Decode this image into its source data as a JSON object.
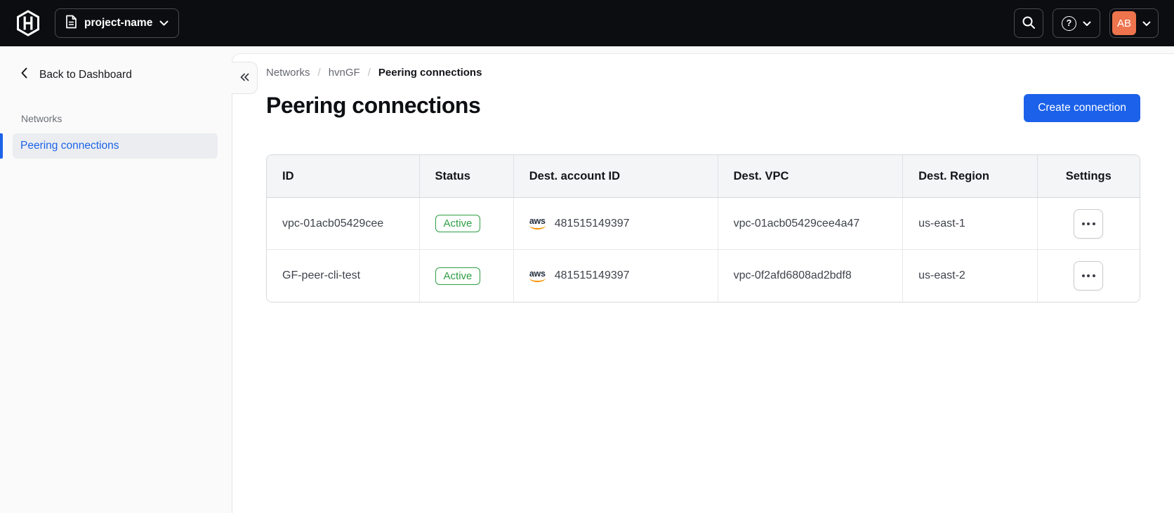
{
  "topbar": {
    "project_name": "project-name",
    "avatar_initials": "AB",
    "help_glyph": "?"
  },
  "sidebar": {
    "back_label": "Back to Dashboard",
    "section_label": "Networks",
    "items": [
      {
        "label": "Peering connections",
        "active": true
      }
    ]
  },
  "breadcrumb": {
    "separator": "/",
    "items": [
      "Networks",
      "hvnGF",
      "Peering connections"
    ]
  },
  "page": {
    "title": "Peering connections",
    "create_button_label": "Create connection"
  },
  "table": {
    "columns": [
      "ID",
      "Status",
      "Dest. account ID",
      "Dest. VPC",
      "Dest. Region",
      "Settings"
    ],
    "aws_label": "aws",
    "rows": [
      {
        "id": "vpc-01acb05429cee",
        "status": "Active",
        "dest_account_id": "481515149397",
        "dest_vpc": "vpc-01acb05429cee4a47",
        "dest_region": "us-east-1"
      },
      {
        "id": "GF-peer-cli-test",
        "status": "Active",
        "dest_account_id": "481515149397",
        "dest_vpc": "vpc-0f2afd6808ad2bdf8",
        "dest_region": "us-east-2"
      }
    ]
  },
  "colors": {
    "topbar_bg": "#0c0d11",
    "accent_blue": "#1b61e9",
    "sidebar_active_blue": "#1c63e8",
    "success_green": "#2f9e44",
    "avatar_orange": "#ee744e",
    "aws_orange": "#f79400"
  },
  "icons": {
    "brand": "hashicorp-logo",
    "project": "document-icon",
    "search": "search-icon",
    "help": "question-circle-icon",
    "dropdowns": "chevron-down-icon",
    "back": "chevron-left-icon",
    "collapse": "double-chevron-left-icon",
    "provider": "aws-icon",
    "row_actions": "ellipsis-icon"
  }
}
